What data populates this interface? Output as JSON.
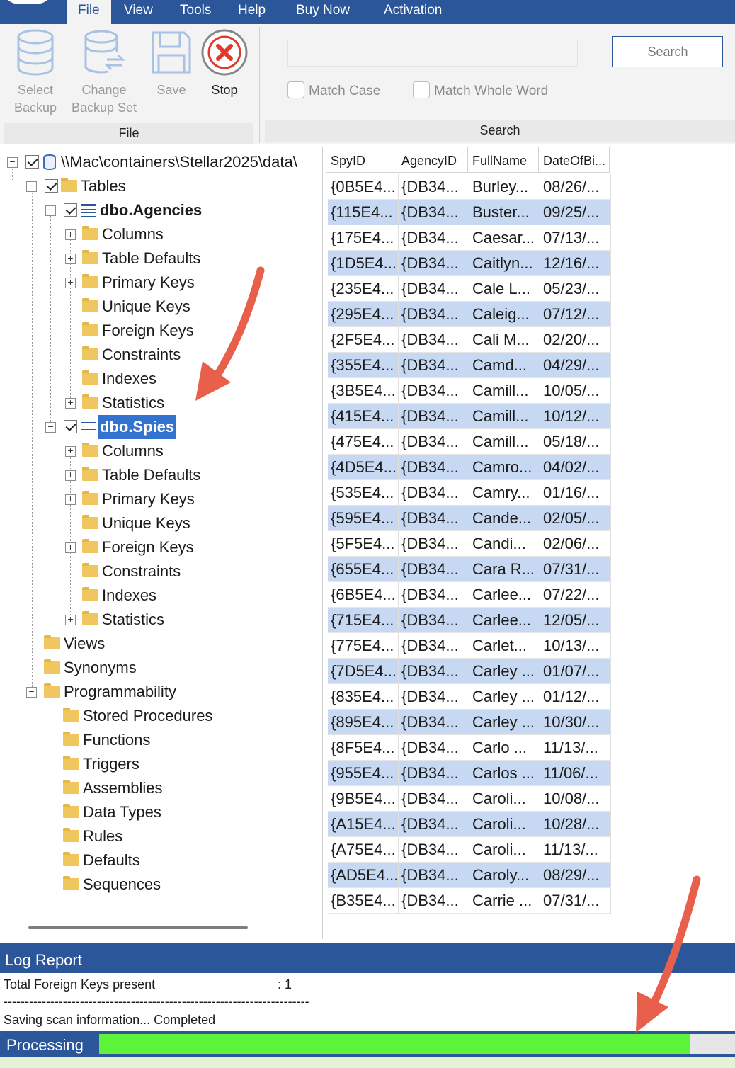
{
  "menu": {
    "items": [
      "File",
      "View",
      "Tools",
      "Help",
      "Buy Now",
      "Activation"
    ]
  },
  "ribbon": {
    "buttons": {
      "select_backup": [
        "Select",
        "Backup"
      ],
      "change_backup_set": [
        "Change",
        "Backup Set"
      ],
      "save": "Save",
      "stop": "Stop"
    },
    "file_group_label": "File",
    "search_group_label": "Search",
    "search": {
      "value": "",
      "button_label": "Search"
    },
    "options": {
      "match_case": "Match Case",
      "match_whole_word": "Match Whole Word"
    }
  },
  "tree": {
    "root": "\\\\Mac\\containers\\Stellar2025\\data\\",
    "tables": "Tables",
    "agencies": "dbo.Agencies",
    "spies": "dbo.Spies",
    "table_children": [
      "Columns",
      "Table Defaults",
      "Primary Keys",
      "Unique Keys",
      "Foreign Keys",
      "Constraints",
      "Indexes",
      "Statistics"
    ],
    "views": "Views",
    "synonyms": "Synonyms",
    "programmability": "Programmability",
    "programmability_children": [
      "Stored Procedures",
      "Functions",
      "Triggers",
      "Assemblies",
      "Data Types",
      "Rules",
      "Defaults",
      "Sequences"
    ]
  },
  "grid": {
    "columns": [
      "SpyID",
      "AgencyID",
      "FullName",
      "DateOfBi..."
    ],
    "rows": [
      [
        "{0B5E4...",
        "{DB34...",
        "Burley...",
        "08/26/..."
      ],
      [
        "{115E4...",
        "{DB34...",
        "Buster...",
        "09/25/..."
      ],
      [
        "{175E4...",
        "{DB34...",
        "Caesar...",
        "07/13/..."
      ],
      [
        "{1D5E4...",
        "{DB34...",
        "Caitlyn...",
        "12/16/..."
      ],
      [
        "{235E4...",
        "{DB34...",
        "Cale L...",
        "05/23/..."
      ],
      [
        "{295E4...",
        "{DB34...",
        "Caleig...",
        "07/12/..."
      ],
      [
        "{2F5E4...",
        "{DB34...",
        "Cali M...",
        "02/20/..."
      ],
      [
        "{355E4...",
        "{DB34...",
        "Camd...",
        "04/29/..."
      ],
      [
        "{3B5E4...",
        "{DB34...",
        "Camill...",
        "10/05/..."
      ],
      [
        "{415E4...",
        "{DB34...",
        "Camill...",
        "10/12/..."
      ],
      [
        "{475E4...",
        "{DB34...",
        "Camill...",
        "05/18/..."
      ],
      [
        "{4D5E4...",
        "{DB34...",
        "Camro...",
        "04/02/..."
      ],
      [
        "{535E4...",
        "{DB34...",
        "Camry...",
        "01/16/..."
      ],
      [
        "{595E4...",
        "{DB34...",
        "Cande...",
        "02/05/..."
      ],
      [
        "{5F5E4...",
        "{DB34...",
        "Candi...",
        "02/06/..."
      ],
      [
        "{655E4...",
        "{DB34...",
        "Cara R...",
        "07/31/..."
      ],
      [
        "{6B5E4...",
        "{DB34...",
        "Carlee...",
        "07/22/..."
      ],
      [
        "{715E4...",
        "{DB34...",
        "Carlee...",
        "12/05/..."
      ],
      [
        "{775E4...",
        "{DB34...",
        "Carlet...",
        "10/13/..."
      ],
      [
        "{7D5E4...",
        "{DB34...",
        "Carley ...",
        "01/07/..."
      ],
      [
        "{835E4...",
        "{DB34...",
        "Carley ...",
        "01/12/..."
      ],
      [
        "{895E4...",
        "{DB34...",
        "Carley ...",
        "10/30/..."
      ],
      [
        "{8F5E4...",
        "{DB34...",
        "Carlo ...",
        "11/13/..."
      ],
      [
        "{955E4...",
        "{DB34...",
        "Carlos ...",
        "11/06/..."
      ],
      [
        "{9B5E4...",
        "{DB34...",
        "Caroli...",
        "10/08/..."
      ],
      [
        "{A15E4...",
        "{DB34...",
        "Caroli...",
        "10/28/..."
      ],
      [
        "{A75E4...",
        "{DB34...",
        "Caroli...",
        "11/13/..."
      ],
      [
        "{AD5E4...",
        "{DB34...",
        "Caroly...",
        "08/29/..."
      ],
      [
        "{B35E4...",
        "{DB34...",
        "Carrie ...",
        "07/31/..."
      ]
    ]
  },
  "log": {
    "title": "Log Report",
    "line1_label": "Total Foreign Keys present",
    "line1_value": ":  1",
    "separator": "------------------------------------------------------------------------",
    "line3": "Saving scan information... Completed"
  },
  "status": {
    "label": "Processing",
    "progress": 0.93
  },
  "colors": {
    "accent": "#2b579a",
    "row_alt": "#c7d8f2",
    "progress": "#5cf33a",
    "annotation_arrow": "#e8604c"
  }
}
